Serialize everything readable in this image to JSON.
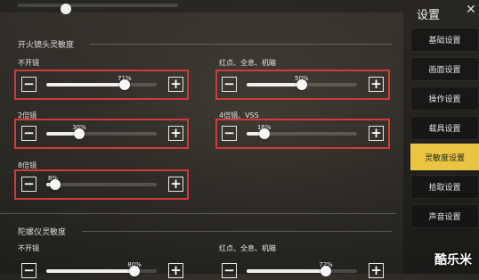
{
  "side_menu": {
    "title": "设置",
    "tabs": [
      {
        "label": "基础设置",
        "active": false
      },
      {
        "label": "画面设置",
        "active": false
      },
      {
        "label": "操作设置",
        "active": false
      },
      {
        "label": "载具设置",
        "active": false
      },
      {
        "label": "灵敏度设置",
        "active": true
      },
      {
        "label": "拾取设置",
        "active": false
      },
      {
        "label": "声音设置",
        "active": false
      }
    ]
  },
  "sections": {
    "fire_camera": {
      "title": "开火镜头灵敏度",
      "sliders": [
        {
          "label": "不开镜",
          "value_label": "71%",
          "value": 0.71
        },
        {
          "label": "红点、全息、机瞄",
          "value_label": "50%",
          "value": 0.5
        },
        {
          "label": "2倍镜",
          "value_label": "30%",
          "value": 0.3
        },
        {
          "label": "4倍镜、VSS",
          "value_label": "16%",
          "value": 0.16
        },
        {
          "label": "8倍镜",
          "value_label": "8%",
          "value": 0.08
        }
      ]
    },
    "gyro": {
      "title": "陀螺仪灵敏度",
      "sliders": [
        {
          "label": "不开镜",
          "value_label": "80%",
          "value": 0.8
        },
        {
          "label": "红点、全息、机瞄",
          "value_label": "72%",
          "value": 0.72
        }
      ]
    }
  },
  "icons": {
    "minus": "−",
    "plus": "+",
    "close": "✕"
  },
  "watermark": "酷乐米",
  "colors": {
    "highlight_border": "#d23a38",
    "active_tab": "#e9c540"
  }
}
